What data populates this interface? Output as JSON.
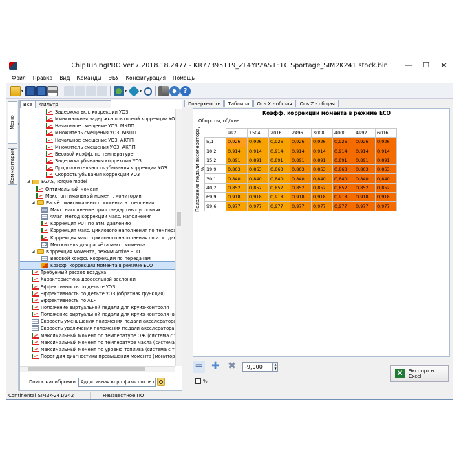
{
  "window": {
    "title": "ChipTuningPRO ver.7.2018.18.2477 - KR77395119_ZL4YP2AS1F1C Sportage_SIM2K241 stock.bin"
  },
  "menu": [
    "Файл",
    "Правка",
    "Вид",
    "Команды",
    "ЭБУ",
    "Конфигурация",
    "Помощь"
  ],
  "side_tabs": {
    "calibrations": "Меню калибровок",
    "comments": "Комментарии"
  },
  "tree_tabs": {
    "all": "Все",
    "filter": "Фильтр"
  },
  "tree": [
    {
      "label": "Задержка вкл. коррекции УОЗ",
      "icon": "map-icon",
      "indent": 4
    },
    {
      "label": "Минимальная задержка повторной коррекции УОЗ",
      "icon": "map-icon",
      "indent": 4
    },
    {
      "label": "Начальное смещение УОЗ, МКПП",
      "icon": "map-icon",
      "indent": 4
    },
    {
      "label": "Множитель смещения УОЗ, МКПП",
      "icon": "map-icon",
      "indent": 4
    },
    {
      "label": "Начальное смещение УОЗ, АКПП",
      "icon": "map-icon",
      "indent": 4
    },
    {
      "label": "Множитель смещения УОЗ, АКПП",
      "icon": "map-icon",
      "indent": 4
    },
    {
      "label": "Весовой коэфф. по температуре",
      "icon": "map-icon",
      "indent": 4
    },
    {
      "label": "Задержка убывания коррекции УОЗ",
      "icon": "map-icon",
      "indent": 4
    },
    {
      "label": "Продолжительность убывания коррекции УОЗ",
      "icon": "map-icon",
      "indent": 4
    },
    {
      "label": "Скорость убывания коррекции УОЗ",
      "icon": "map-icon",
      "indent": 4
    },
    {
      "label": "EGAS, Torque model",
      "icon": "folder-icon",
      "indent": 0,
      "expander": "◢"
    },
    {
      "label": "Оптимальный момент",
      "icon": "map-icon",
      "indent": 2
    },
    {
      "label": "Макс. оптимальный момент, мониторинг",
      "icon": "map-icon",
      "indent": 2
    },
    {
      "label": "Расчёт максимального момента в сцеплении",
      "icon": "folder-icon",
      "indent": 1,
      "expander": "◢"
    },
    {
      "label": "Макс. наполнение при стандартных условиях",
      "icon": "list-icon",
      "indent": 3
    },
    {
      "label": "Флаг: метод коррекции макс. наполнения",
      "icon": "list-icon",
      "indent": 3
    },
    {
      "label": "Коррекция PUT по атм. давлению",
      "icon": "map-icon",
      "indent": 3
    },
    {
      "label": "Коррекция макс. циклового наполнения по температ",
      "icon": "map-icon",
      "indent": 3
    },
    {
      "label": "Коррекция макс. циклового наполнения по атм. давл",
      "icon": "map-icon",
      "indent": 3
    },
    {
      "label": "Множитель для расчёта макс. момента",
      "icon": "value-icon",
      "indent": 3
    },
    {
      "label": "Коррекция момента, режим Active ECO",
      "icon": "folder-icon",
      "indent": 1,
      "expander": "◢"
    },
    {
      "label": "Весовой коэфф. коррекции по передачам",
      "icon": "list-icon",
      "indent": 3
    },
    {
      "label": "Коэфф. коррекции момента в режиме ECO",
      "icon": "3d-map-icon",
      "indent": 3,
      "selected": true
    },
    {
      "label": "Требуемый расход воздуха",
      "icon": "map-icon",
      "indent": 1
    },
    {
      "label": "Характеристика дроссельной заслонки",
      "icon": "map-icon",
      "indent": 1
    },
    {
      "label": "Эффективность по дельте УОЗ",
      "icon": "map-icon",
      "indent": 1
    },
    {
      "label": "Эффективность по дельте УОЗ (обратная функция)",
      "icon": "map-icon",
      "indent": 1
    },
    {
      "label": "Эффективность по ALF",
      "icon": "map-icon",
      "indent": 1
    },
    {
      "label": "Положение виртуальной педали для круиз-контроля",
      "icon": "map-icon",
      "indent": 1
    },
    {
      "label": "Положение виртуальной педали для круиз-контроля (вре",
      "icon": "map-icon",
      "indent": 1
    },
    {
      "label": "Скорость уменьшения положения педали акселератора",
      "icon": "list-icon",
      "indent": 1
    },
    {
      "label": "Скорость увеличения положения педали акселератора",
      "icon": "list-icon",
      "indent": 1
    },
    {
      "label": "Максимальный момент по температуре ОЖ (система с турб",
      "icon": "map-icon",
      "indent": 1
    },
    {
      "label": "Максимальный момент по температуре масла (система с тур",
      "icon": "map-icon",
      "indent": 1
    },
    {
      "label": "Максимальный момент по уровню топлива (система с тур",
      "icon": "map-icon",
      "indent": 1
    },
    {
      "label": "Порог для диагностики превышения момента (мониторин",
      "icon": "map-icon",
      "indent": 1
    }
  ],
  "search": {
    "label": "Поиск калибровки",
    "value": "Аддитивная корр.фазы после пуска (хол.д"
  },
  "right_tabs": [
    "Поверхность",
    "Таблица",
    "Ось X - общая",
    "Ось Z - общая"
  ],
  "map": {
    "title": "Коэфф. коррекции момента в режиме ECO",
    "x_label": "Обороты, об/мин",
    "y_label": "Положение педали акселератора, %",
    "x_values": [
      "992",
      "1504",
      "2016",
      "2496",
      "3008",
      "4000",
      "4992",
      "6016"
    ],
    "y_values": [
      "5,1",
      "10,2",
      "15,2",
      "19,9",
      "30,1",
      "40,2",
      "69,9",
      "99,6"
    ],
    "cells": [
      [
        "0,926",
        "0,926",
        "0,926",
        "0,926",
        "0,926",
        "0,926",
        "0,926",
        "0,926"
      ],
      [
        "0,914",
        "0,914",
        "0,914",
        "0,914",
        "0,914",
        "0,914",
        "0,914",
        "0,914"
      ],
      [
        "0,891",
        "0,891",
        "0,891",
        "0,891",
        "0,891",
        "0,891",
        "0,891",
        "0,891"
      ],
      [
        "0,863",
        "0,863",
        "0,863",
        "0,863",
        "0,863",
        "0,863",
        "0,863",
        "0,863"
      ],
      [
        "0,840",
        "0,840",
        "0,840",
        "0,840",
        "0,840",
        "0,840",
        "0,840",
        "0,840"
      ],
      [
        "0,852",
        "0,852",
        "0,852",
        "0,852",
        "0,852",
        "0,852",
        "0,852",
        "0,852"
      ],
      [
        "0,918",
        "0,918",
        "0,918",
        "0,918",
        "0,918",
        "0,918",
        "0,918",
        "0,918"
      ],
      [
        "0,977",
        "0,977",
        "0,977",
        "0,977",
        "0,977",
        "0,977",
        "0,977",
        "0,977"
      ]
    ],
    "colors": {
      "low": "#f7a200",
      "high": "#f46c00",
      "selected": "#ff9d1a"
    }
  },
  "edit": {
    "value": "-9,000",
    "percent_label": "%"
  },
  "export": {
    "label": "Экспорт в Excel"
  },
  "status": {
    "ecu": "Continental SIM2K-241/242",
    "software": "Неизвестное ПО"
  },
  "colors": {
    "accent": "#3b6ea5",
    "excel": "#1e7b34"
  }
}
